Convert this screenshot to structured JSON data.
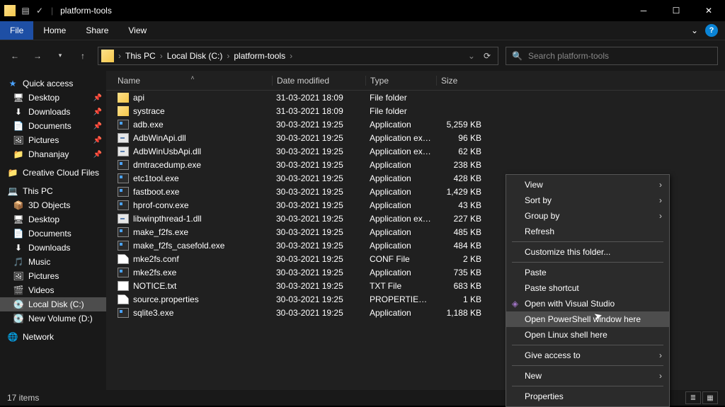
{
  "window": {
    "title": "platform-tools"
  },
  "ribbon": {
    "file": "File",
    "tabs": [
      "Home",
      "Share",
      "View"
    ]
  },
  "breadcrumb": [
    "This PC",
    "Local Disk (C:)",
    "platform-tools"
  ],
  "search": {
    "placeholder": "Search platform-tools"
  },
  "columns": {
    "name": "Name",
    "date": "Date modified",
    "type": "Type",
    "size": "Size"
  },
  "nav": {
    "quick": "Quick access",
    "pinned": [
      {
        "label": "Desktop",
        "icon": "desktop"
      },
      {
        "label": "Downloads",
        "icon": "downloads"
      },
      {
        "label": "Documents",
        "icon": "documents"
      },
      {
        "label": "Pictures",
        "icon": "pictures"
      },
      {
        "label": "Dhananjay",
        "icon": "userfolder"
      }
    ],
    "ccf": "Creative Cloud Files",
    "thispc": "This PC",
    "pcitems": [
      {
        "label": "3D Objects",
        "icon": "3d"
      },
      {
        "label": "Desktop",
        "icon": "desktop"
      },
      {
        "label": "Documents",
        "icon": "documents"
      },
      {
        "label": "Downloads",
        "icon": "downloads"
      },
      {
        "label": "Music",
        "icon": "music"
      },
      {
        "label": "Pictures",
        "icon": "pictures"
      },
      {
        "label": "Videos",
        "icon": "videos"
      },
      {
        "label": "Local Disk (C:)",
        "icon": "drive",
        "selected": true
      },
      {
        "label": "New Volume (D:)",
        "icon": "drive"
      }
    ],
    "network": "Network"
  },
  "files": [
    {
      "name": "api",
      "date": "31-03-2021 18:09",
      "type": "File folder",
      "size": "",
      "icon": "folder"
    },
    {
      "name": "systrace",
      "date": "31-03-2021 18:09",
      "type": "File folder",
      "size": "",
      "icon": "folder"
    },
    {
      "name": "adb.exe",
      "date": "30-03-2021 19:25",
      "type": "Application",
      "size": "5,259 KB",
      "icon": "exe"
    },
    {
      "name": "AdbWinApi.dll",
      "date": "30-03-2021 19:25",
      "type": "Application exten...",
      "size": "96 KB",
      "icon": "dll"
    },
    {
      "name": "AdbWinUsbApi.dll",
      "date": "30-03-2021 19:25",
      "type": "Application exten...",
      "size": "62 KB",
      "icon": "dll"
    },
    {
      "name": "dmtracedump.exe",
      "date": "30-03-2021 19:25",
      "type": "Application",
      "size": "238 KB",
      "icon": "exe"
    },
    {
      "name": "etc1tool.exe",
      "date": "30-03-2021 19:25",
      "type": "Application",
      "size": "428 KB",
      "icon": "exe"
    },
    {
      "name": "fastboot.exe",
      "date": "30-03-2021 19:25",
      "type": "Application",
      "size": "1,429 KB",
      "icon": "exe"
    },
    {
      "name": "hprof-conv.exe",
      "date": "30-03-2021 19:25",
      "type": "Application",
      "size": "43 KB",
      "icon": "exe"
    },
    {
      "name": "libwinpthread-1.dll",
      "date": "30-03-2021 19:25",
      "type": "Application exten...",
      "size": "227 KB",
      "icon": "dll"
    },
    {
      "name": "make_f2fs.exe",
      "date": "30-03-2021 19:25",
      "type": "Application",
      "size": "485 KB",
      "icon": "exe"
    },
    {
      "name": "make_f2fs_casefold.exe",
      "date": "30-03-2021 19:25",
      "type": "Application",
      "size": "484 KB",
      "icon": "exe"
    },
    {
      "name": "mke2fs.conf",
      "date": "30-03-2021 19:25",
      "type": "CONF File",
      "size": "2 KB",
      "icon": "conf"
    },
    {
      "name": "mke2fs.exe",
      "date": "30-03-2021 19:25",
      "type": "Application",
      "size": "735 KB",
      "icon": "exe"
    },
    {
      "name": "NOTICE.txt",
      "date": "30-03-2021 19:25",
      "type": "TXT File",
      "size": "683 KB",
      "icon": "txt"
    },
    {
      "name": "source.properties",
      "date": "30-03-2021 19:25",
      "type": "PROPERTIES File",
      "size": "1 KB",
      "icon": "conf"
    },
    {
      "name": "sqlite3.exe",
      "date": "30-03-2021 19:25",
      "type": "Application",
      "size": "1,188 KB",
      "icon": "exe"
    }
  ],
  "context": {
    "view": "View",
    "sort": "Sort by",
    "group": "Group by",
    "refresh": "Refresh",
    "customize": "Customize this folder...",
    "paste": "Paste",
    "paste_shortcut": "Paste shortcut",
    "open_vs": "Open with Visual Studio",
    "open_ps": "Open PowerShell window here",
    "open_linux": "Open Linux shell here",
    "give_access": "Give access to",
    "new": "New",
    "properties": "Properties"
  },
  "status": {
    "count": "17 items"
  },
  "icons": {
    "star": "★",
    "desktop": "🖥",
    "downloads": "⬇",
    "documents": "📄",
    "pictures": "🖼",
    "userfolder": "📁",
    "ccf": "📁",
    "thispc": "💻",
    "3d": "📦",
    "music": "🎵",
    "videos": "🎬",
    "drive": "💽",
    "network": "🌐",
    "vs": "▧"
  }
}
